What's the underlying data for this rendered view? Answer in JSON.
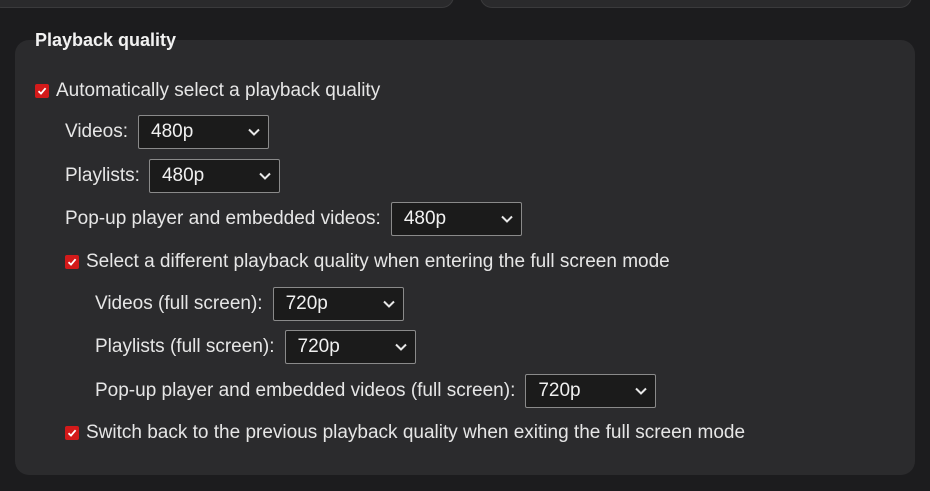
{
  "section": {
    "title": "Playback quality"
  },
  "auto_quality": {
    "label": "Automatically select a playback quality",
    "checked": true,
    "videos": {
      "label": "Videos:",
      "value": "480p"
    },
    "playlists": {
      "label": "Playlists:",
      "value": "480p"
    },
    "popup": {
      "label": "Pop-up player and embedded videos:",
      "value": "480p"
    }
  },
  "fullscreen_quality": {
    "label": "Select a different playback quality when entering the full screen mode",
    "checked": true,
    "videos": {
      "label": "Videos (full screen):",
      "value": "720p"
    },
    "playlists": {
      "label": "Playlists (full screen):",
      "value": "720p"
    },
    "popup": {
      "label": "Pop-up player and embedded videos (full screen):",
      "value": "720p"
    }
  },
  "switch_back": {
    "label": "Switch back to the previous playback quality when exiting the full screen mode",
    "checked": true
  },
  "colors": {
    "checkbox_accent": "#d31a1a",
    "panel_bg": "#2b2b2d",
    "page_bg": "#1c1c1e"
  }
}
